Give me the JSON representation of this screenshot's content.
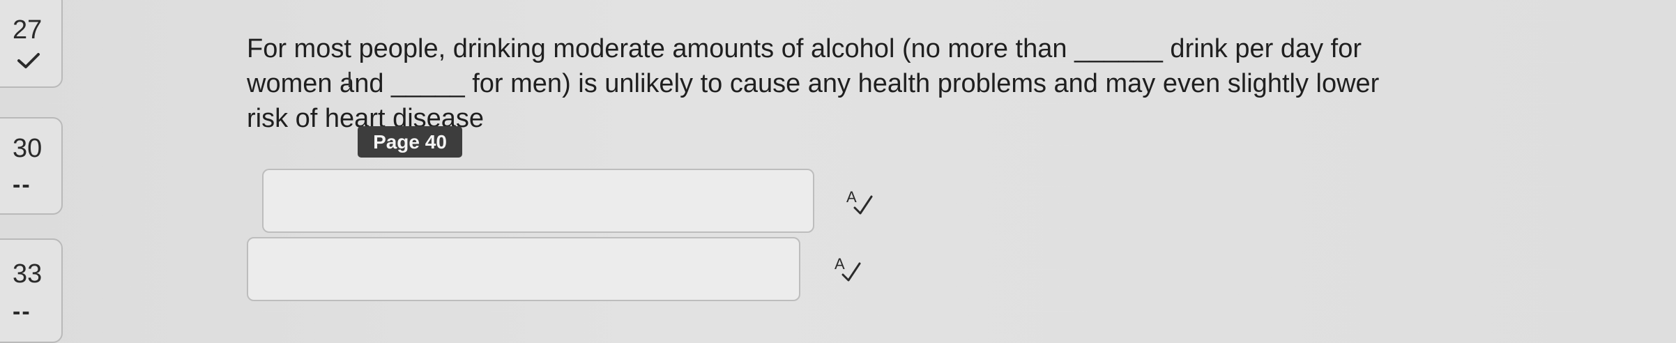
{
  "nav": {
    "items": [
      {
        "number": "27",
        "status_icon": "checkmark-icon"
      },
      {
        "number": "30",
        "status": "--"
      },
      {
        "number": "33",
        "status": "--"
      }
    ]
  },
  "question": {
    "text": "For most people, drinking moderate amounts of alcohol (no more than ______ drink per day for women and _____ for men) is unlikely to cause any health problems and may even slightly lower risk of heart disease"
  },
  "tooltip": {
    "text": "Page 40"
  },
  "answers": [
    {
      "value": "",
      "spellcheck_icon": "spellcheck-icon"
    },
    {
      "value": "",
      "spellcheck_icon": "spellcheck-icon"
    }
  ],
  "cursor_icon": "text-cursor-icon"
}
